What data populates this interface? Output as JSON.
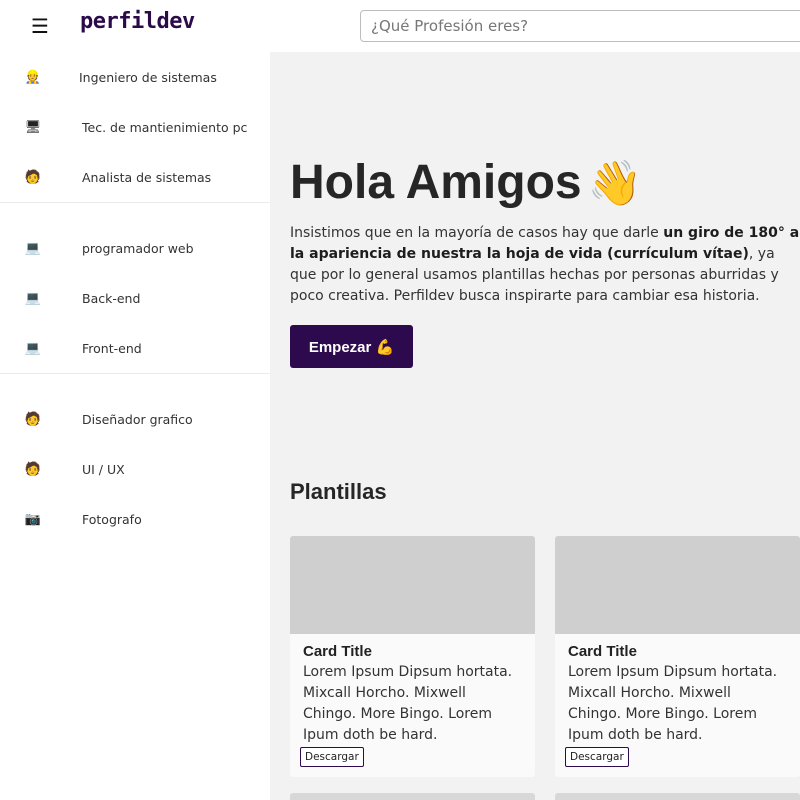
{
  "header": {
    "logo": "perfildev",
    "menu_icon": "hamburger-icon",
    "search_placeholder": "¿Qué Profesión eres?"
  },
  "sidebar": {
    "groups": [
      {
        "items": [
          {
            "icon": "engineer-emoji",
            "label": "Ingeniero de sistemas"
          },
          {
            "icon": "computer-emoji",
            "label": "Tec. de mantienimiento pc"
          },
          {
            "icon": "analyst-emoji",
            "label": "Analista de sistemas"
          }
        ]
      },
      {
        "items": [
          {
            "icon": "developer-emoji",
            "label": "programador web"
          },
          {
            "icon": "developer-emoji",
            "label": "Back-end"
          },
          {
            "icon": "developer-emoji",
            "label": "Front-end"
          }
        ]
      },
      {
        "items": [
          {
            "icon": "designer-emoji",
            "label": "Diseñador grafico"
          },
          {
            "icon": "designer-emoji",
            "label": "UI / UX"
          },
          {
            "icon": "camera-emoji",
            "label": "Fotografo"
          }
        ]
      }
    ]
  },
  "hero": {
    "title": "Hola Amigos",
    "title_icon": "waving-hand-emoji",
    "text_part1": "Insistimos que en la mayoría de casos hay que darle ",
    "text_bold": "un giro de 180° a la apariencia de nuestra la hoja de vida (currículum vítae)",
    "text_part2": ", ya que por lo general usamos plantillas hechas por personas aburridas y poco creativa. Perfildev busca inspirarte para cambiar esa historia.",
    "cta_label": "Empezar 💪"
  },
  "templates": {
    "title": "Plantillas",
    "cards": [
      {
        "title": "Card Title",
        "text": "Lorem Ipsum Dipsum hortata. Mixcall Horcho. Mixwell Chingo. More Bingo. Lorem Ipum doth be hard.",
        "button": "Descargar"
      },
      {
        "title": "Card Title",
        "text": "Lorem Ipsum Dipsum hortata. Mixcall Horcho. Mixwell Chingo. More Bingo. Lorem Ipum doth be hard.",
        "button": "Descargar"
      }
    ]
  }
}
